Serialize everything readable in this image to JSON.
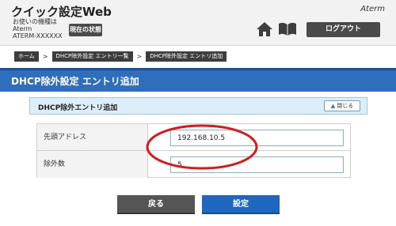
{
  "header": {
    "title": "クイック設定Web",
    "device_line1": "お使いの機種は",
    "device_line2": "Aterm",
    "device_line3": "ATERM-XXXXXX",
    "status_button": "現在の状態",
    "brand": "Aterm",
    "logout_button": "ログアウト",
    "home_icon": "home-icon",
    "book_icon": "book-icon"
  },
  "breadcrumb": {
    "items": [
      "ホーム",
      "DHCP除外設定 エントリ一覧",
      "DHCP除外設定 エントリ追加"
    ],
    "separator": ">"
  },
  "page": {
    "heading": "DHCP除外設定 エントリ追加"
  },
  "section": {
    "title": "DHCP除外エントリ追加",
    "collapse_label": "閉じる"
  },
  "form": {
    "fields": [
      {
        "label": "先頭アドレス",
        "value": "192.168.10.5"
      },
      {
        "label": "除外数",
        "value": "5"
      }
    ]
  },
  "buttons": {
    "back": "戻る",
    "save": "設定"
  },
  "colors": {
    "heading_blue": "#2f6dbd",
    "save_blue": "#1f66c1",
    "highlight_red": "#e01515"
  }
}
